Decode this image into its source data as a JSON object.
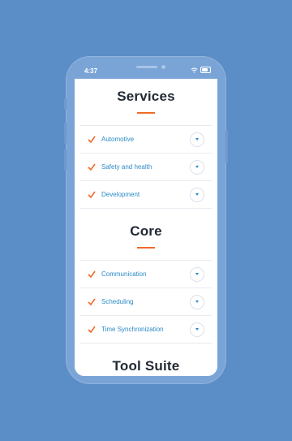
{
  "status_bar": {
    "time": "4:37"
  },
  "sections": [
    {
      "title": "Services",
      "items": [
        "Automotive",
        "Safety and health",
        "Development"
      ]
    },
    {
      "title": "Core",
      "items": [
        "Communication",
        "Scheduling",
        "Time Synchronization"
      ]
    },
    {
      "title": "Tool Suite",
      "items": []
    }
  ],
  "colors": {
    "background": "#5b8dc6",
    "accent": "#f06a28",
    "link": "#2b8ac6"
  },
  "icons": {
    "check": "check-icon",
    "expand": "chevron-down-icon",
    "wifi": "wifi-icon",
    "battery": "battery-icon"
  }
}
